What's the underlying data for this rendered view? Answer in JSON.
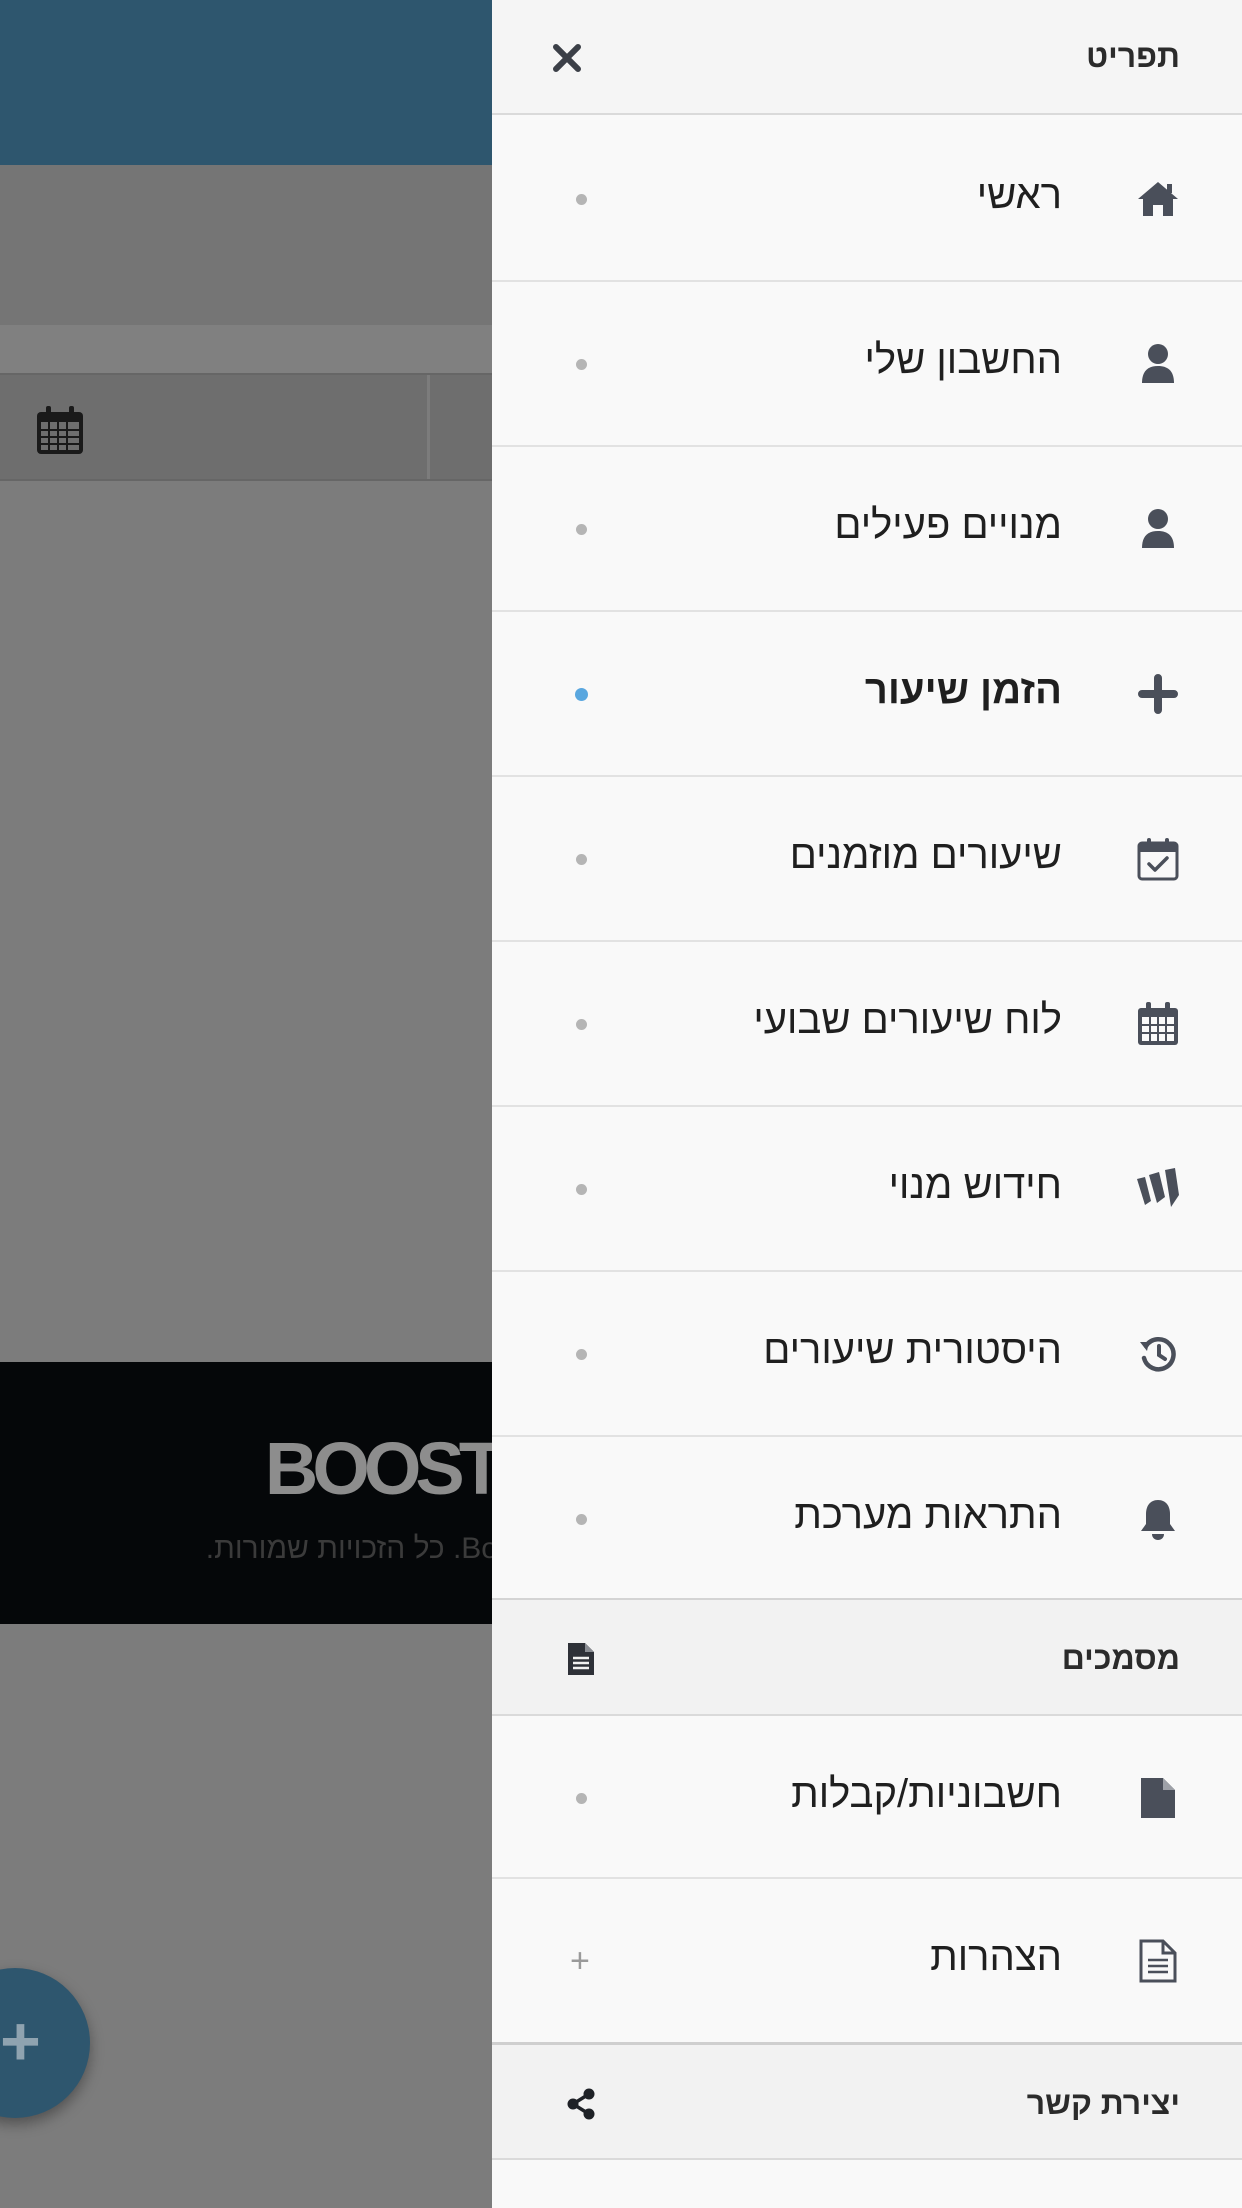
{
  "background": {
    "footer_logo": "BOOST",
    "footer_copyright": "Bo. כל הזכויות שמורות.",
    "fab_symbol": "+"
  },
  "drawer": {
    "title": "תפריט",
    "close_icon": "close-icon",
    "items": [
      {
        "label": "ראשי",
        "icon": "home-icon",
        "marker": "dot",
        "active": false
      },
      {
        "label": "החשבון שלי",
        "icon": "user-icon",
        "marker": "dot",
        "active": false
      },
      {
        "label": "מנויים פעילים",
        "icon": "user-icon",
        "marker": "dot",
        "active": false
      },
      {
        "label": "הזמן שיעור",
        "icon": "plus-icon",
        "marker": "dot",
        "active": true
      },
      {
        "label": "שיעורים מוזמנים",
        "icon": "calendar-check-icon",
        "marker": "dot",
        "active": false
      },
      {
        "label": "לוח שיעורים שבועי",
        "icon": "calendar-icon",
        "marker": "dot",
        "active": false
      },
      {
        "label": "חידוש מנוי",
        "icon": "brand-logo-icon",
        "marker": "dot",
        "active": false
      },
      {
        "label": "היסטורית שיעורים",
        "icon": "history-icon",
        "marker": "dot",
        "active": false
      },
      {
        "label": "התראות מערכת",
        "icon": "bell-icon",
        "marker": "dot",
        "active": false
      }
    ],
    "documents_section": {
      "title": "מסמכים",
      "icon": "document-icon",
      "items": [
        {
          "label": "חשבוניות/קבלות",
          "icon": "file-icon",
          "marker": "dot"
        },
        {
          "label": "הצהרות",
          "icon": "file-text-icon",
          "marker": "+"
        }
      ]
    },
    "contact_section": {
      "title": "יצירת קשר",
      "icon": "share-icon"
    }
  },
  "colors": {
    "header_blue": "#2e566e",
    "active_dot": "#5aa7df",
    "icon_dark": "#4a4f5a"
  }
}
